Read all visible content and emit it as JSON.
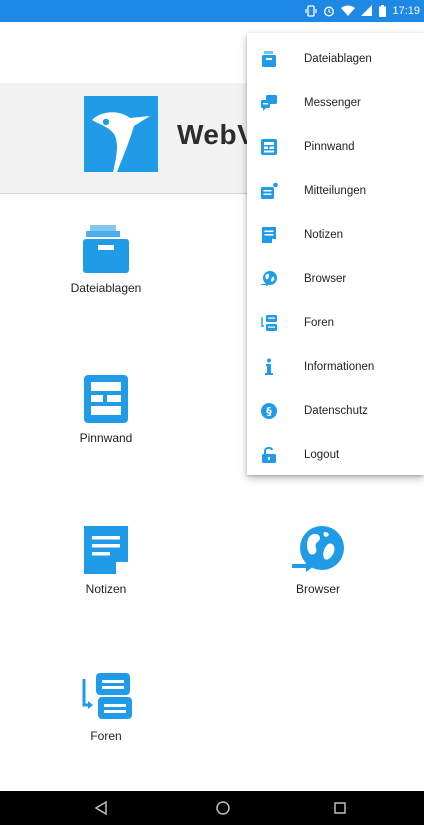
{
  "status_bar": {
    "time": "17:19",
    "color": "#1e88e5"
  },
  "logo": {
    "text": "WebV"
  },
  "tiles": [
    {
      "label": "Dateiablagen",
      "icon": "folder-icon"
    },
    {
      "label": "Pinnwand",
      "icon": "board-icon"
    },
    {
      "label": "Notizen",
      "icon": "note-icon"
    },
    {
      "label": "Browser",
      "icon": "globe-icon"
    },
    {
      "label": "Foren",
      "icon": "forum-icon"
    }
  ],
  "menu": {
    "items": [
      {
        "label": "Dateiablagen",
        "icon": "folder-icon"
      },
      {
        "label": "Messenger",
        "icon": "chat-icon"
      },
      {
        "label": "Pinnwand",
        "icon": "board-icon"
      },
      {
        "label": "Mitteilungen",
        "icon": "message-icon"
      },
      {
        "label": "Notizen",
        "icon": "note-icon"
      },
      {
        "label": "Browser",
        "icon": "globe-icon"
      },
      {
        "label": "Foren",
        "icon": "forum-icon"
      },
      {
        "label": "Informationen",
        "icon": "info-icon"
      },
      {
        "label": "Datenschutz",
        "icon": "privacy-icon"
      },
      {
        "label": "Logout",
        "icon": "lock-open-icon"
      }
    ]
  },
  "accent_color": "#1f9be8"
}
